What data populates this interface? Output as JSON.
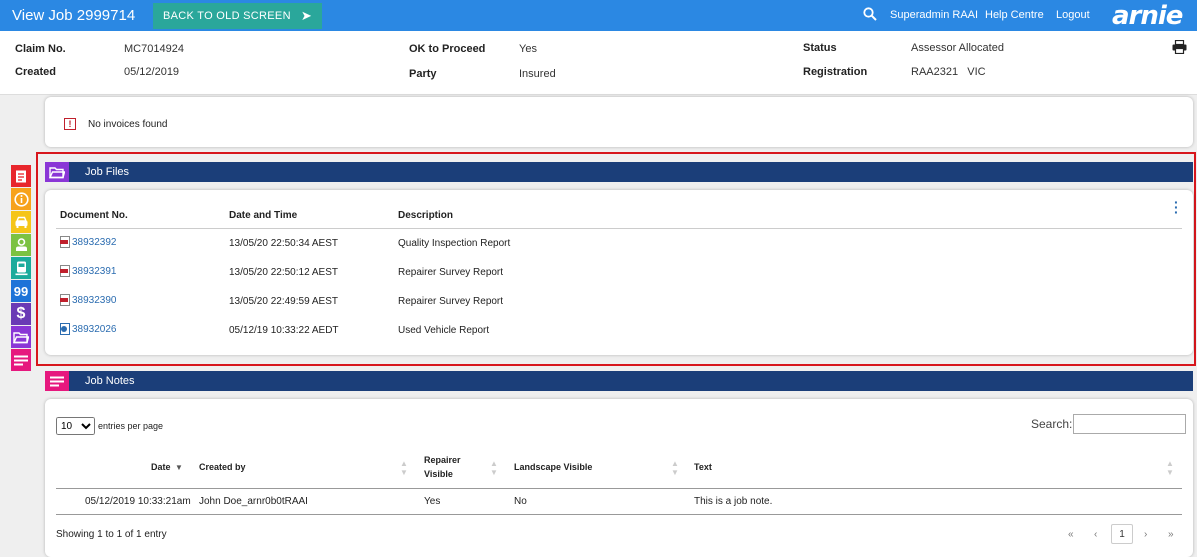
{
  "topbar": {
    "title": "View Job 2999714",
    "back_button": "BACK TO OLD SCREEN",
    "user": "Superadmin RAAI",
    "help": "Help Centre",
    "logout": "Logout",
    "logo": "arnie"
  },
  "header": {
    "claim_label": "Claim No.",
    "claim_value": "MC7014924",
    "created_label": "Created",
    "created_value": "05/12/2019",
    "ok_label": "OK to Proceed",
    "ok_value": "Yes",
    "party_label": "Party",
    "party_value": "Insured",
    "status_label": "Status",
    "status_value": "Assessor Allocated",
    "registration_label": "Registration",
    "registration_value": "RAA2321   VIC"
  },
  "invoices": {
    "message": "No invoices found"
  },
  "job_files": {
    "title": "Job Files",
    "columns": [
      "Document No.",
      "Date and Time",
      "Description"
    ],
    "rows": [
      {
        "doc": "38932392",
        "datetime": "13/05/20 22:50:34 AEST",
        "description": "Quality Inspection Report",
        "icon": "pdf-icon"
      },
      {
        "doc": "38932391",
        "datetime": "13/05/20 22:50:12 AEST",
        "description": "Repairer Survey Report",
        "icon": "pdf-icon"
      },
      {
        "doc": "38932390",
        "datetime": "13/05/20 22:49:59 AEST",
        "description": "Repairer Survey Report",
        "icon": "pdf-icon"
      },
      {
        "doc": "38932026",
        "datetime": "05/12/19 10:33:22 AEDT",
        "description": "Used Vehicle Report",
        "icon": "document-icon"
      }
    ]
  },
  "job_notes": {
    "title": "Job Notes",
    "entries_value": "10",
    "entries_label": "entries per page",
    "search_label": "Search:",
    "columns": {
      "date": "Date",
      "created_by": "Created by",
      "repairer_visible_line1": "Repairer",
      "repairer_visible_line2": "Visible",
      "landscape_visible": "Landscape Visible",
      "text": "Text"
    },
    "rows": [
      {
        "date": "05/12/2019 10:33:21am",
        "created_by": "John Doe_arnr0b0tRAAI",
        "repairer_visible": "Yes",
        "landscape_visible": "No",
        "text": "This is a job note."
      }
    ],
    "showing": "Showing 1 to 1 of 1 entry",
    "pagination": {
      "first": "«",
      "prev": "‹",
      "current": "1",
      "next": "›",
      "last": "»"
    }
  },
  "side_icons": [
    {
      "name": "claim-icon",
      "color": "#e8262c"
    },
    {
      "name": "info-icon",
      "color": "#f7a21b"
    },
    {
      "name": "car-icon",
      "color": "#f5c518"
    },
    {
      "name": "person-icon",
      "color": "#7cc242"
    },
    {
      "name": "bus-icon",
      "color": "#1bab9c"
    },
    {
      "name": "quote-icon",
      "color": "#1e73d8"
    },
    {
      "name": "dollar-icon",
      "color": "#6a3ab5"
    },
    {
      "name": "folder-icon",
      "color": "#8a36d6"
    },
    {
      "name": "notes-icon",
      "color": "#e6187e"
    }
  ]
}
